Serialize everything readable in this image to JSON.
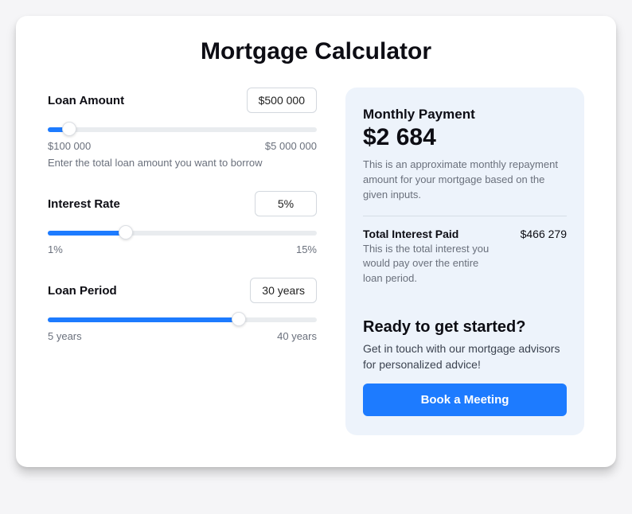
{
  "title": "Mortgage Calculator",
  "loan_amount": {
    "label": "Loan Amount",
    "value": "$500 000",
    "min_label": "$100 000",
    "max_label": "$5 000 000",
    "helper": "Enter the total loan amount you want to borrow",
    "fill_pct": 8
  },
  "interest_rate": {
    "label": "Interest Rate",
    "value": "5%",
    "min_label": "1%",
    "max_label": "15%",
    "fill_pct": 29
  },
  "loan_period": {
    "label": "Loan Period",
    "value": "30 years",
    "min_label": "5 years",
    "max_label": "40 years",
    "fill_pct": 71
  },
  "result": {
    "monthly_label": "Monthly Payment",
    "monthly_value": "$2 684",
    "monthly_desc": "This is an approximate monthly repayment amount for your mortgage based on the given inputs.",
    "interest_label": "Total Interest Paid",
    "interest_value": "$466 279",
    "interest_desc": "This is the total interest you would pay over the entire loan period."
  },
  "cta": {
    "heading": "Ready to get started?",
    "sub": "Get in touch with our mortgage advisors for personalized advice!",
    "button": "Book a Meeting"
  }
}
